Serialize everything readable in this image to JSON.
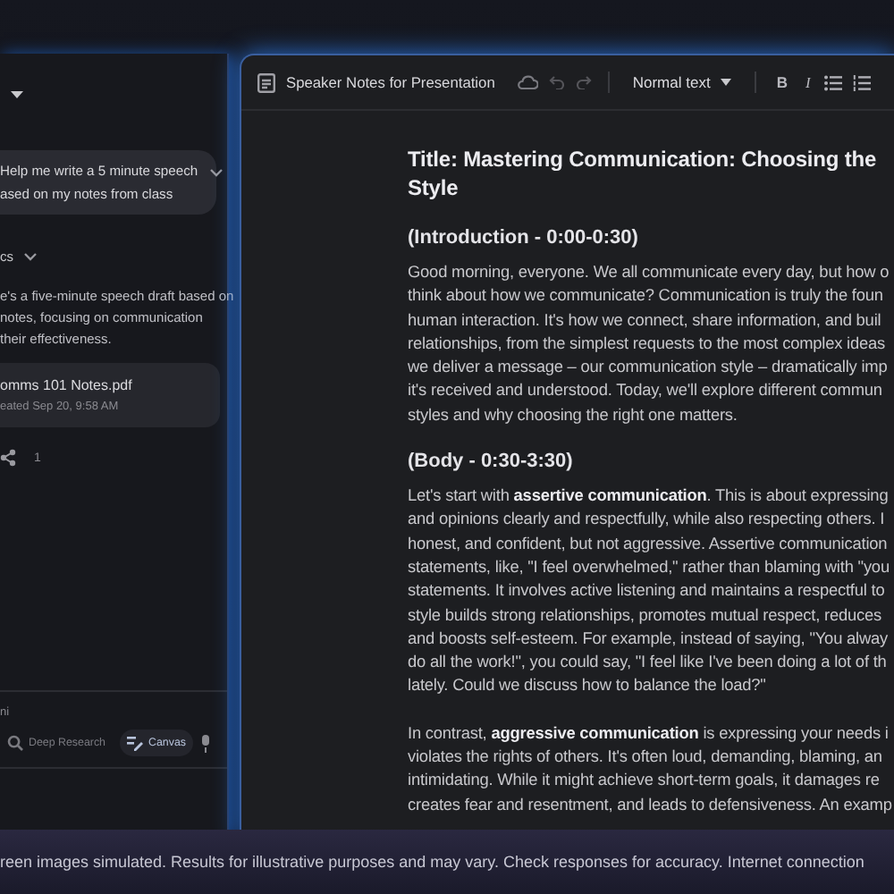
{
  "chat": {
    "user_prompt": {
      "lines": [
        "Help me write a 5 minute speech",
        "ased on my notes from class"
      ]
    },
    "thinking_label": "cs",
    "response_lines": [
      "e's a five-minute speech draft based on",
      "notes, focusing on communication",
      "their effectiveness."
    ],
    "file": {
      "name": "omms 101 Notes.pdf",
      "meta": "eated Sep 20, 9:58 AM"
    },
    "action_count": "1",
    "input_placeholder": "ni",
    "tools": [
      {
        "label": "Deep Research",
        "selected": false
      },
      {
        "label": "Canvas",
        "selected": true
      }
    ]
  },
  "document": {
    "title": "Speaker Notes for Presentation",
    "style_select": "Normal text",
    "format_buttons": [
      {
        "kind": "bold",
        "label": "B"
      },
      {
        "kind": "italic",
        "label": "I"
      },
      {
        "kind": "bullets"
      },
      {
        "kind": "numbers"
      }
    ],
    "blocks": [
      {
        "kind": "title",
        "lines": [
          "Title: Mastering Communication: Choosing the",
          "Style"
        ]
      },
      {
        "kind": "heading",
        "lines": [
          "(Introduction - 0:00-0:30)"
        ]
      },
      {
        "kind": "paragraph",
        "lines": [
          "Good morning, everyone. We all communicate every day, but how o",
          "think about how we communicate? Communication is truly the foun",
          "human interaction. It's how we connect, share information, and buil",
          "relationships, from the simplest requests to the most complex ideas",
          "we deliver a message – our communication style – dramatically imp",
          "it's received and understood. Today, we'll explore different commun",
          "styles and why choosing the right one matters."
        ]
      },
      {
        "kind": "heading",
        "lines": [
          "(Body - 0:30-3:30)"
        ]
      },
      {
        "kind": "paragraph",
        "lines": [
          "Let's start with **assertive communication**. This is about expressing",
          "and opinions clearly and respectfully, while also respecting others. I",
          "honest, and confident, but not aggressive. Assertive communication",
          "statements, like, \"I feel overwhelmed,\" rather than blaming with \"you",
          "statements. It involves active listening and maintains a respectful to",
          "style builds strong relationships, promotes mutual respect, reduces",
          "and boosts self-esteem. For example, instead of saying, \"You alway",
          "do all the work!\", you could say, \"I feel like I've been doing a lot of th",
          "lately. Could we discuss how to balance the load?\""
        ]
      },
      {
        "kind": "paragraph",
        "lines": [
          "In contrast, **aggressive communication** is expressing your needs i",
          "violates the rights of others. It's often loud, demanding, blaming, an",
          "intimidating. While it might achieve short-term goals, it damages re",
          "creates fear and resentment, and leads to defensiveness. An examp"
        ]
      }
    ]
  },
  "disclaimer": "reen images simulated. Results for illustrative purposes and may vary. Check responses for accuracy. Internet connection"
}
